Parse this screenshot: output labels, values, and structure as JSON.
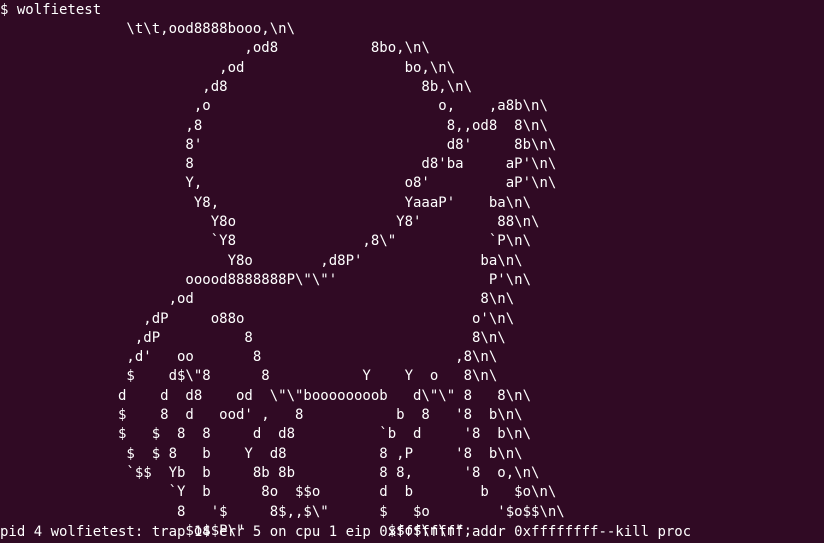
{
  "terminal": {
    "prompt": "$ wolfietest",
    "art_lines": [
      "               \\t\\t,ood8888booo,\\n\\",
      "                             ,od8           8bo,\\n\\",
      "                          ,od                   bo,\\n\\",
      "                        ,d8                       8b,\\n\\",
      "                       ,o                           o,    ,a8b\\n\\",
      "                      ,8                             8,,od8  8\\n\\",
      "                      8'                             d8'     8b\\n\\",
      "                      8                           d8'ba     aP'\\n\\",
      "                      Y,                        o8'         aP'\\n\\",
      "                       Y8,                      YaaaP'    ba\\n\\",
      "                         Y8o                   Y8'         88\\n\\",
      "                         `Y8               ,8\\\"           `P\\n\\",
      "                           Y8o        ,d8P'              ba\\n\\",
      "                      ooood8888888P\\\"\\\"'                  P'\\n\\",
      "                    ,od                                  8\\n\\",
      "                 ,dP     o88o                           o'\\n\\",
      "                ,dP          8                          8\\n\\",
      "               ,d'   oo       8                       ,8\\n\\",
      "               $    d$\\\"8      8           Y    Y  o   8\\n\\",
      "              d    d  d8    od  \\\"\\\"boooooooob   d\\\"\\\" 8   8\\n\\",
      "              $    8  d   ood' ,   8           b  8   '8  b\\n\\",
      "              $   $  8  8     d  d8          `b  d     '8  b\\n\\",
      "               $  $ 8   b    Y  d8           8 ,P     '8  b\\n\\",
      "               `$$  Yb  b     8b 8b          8 8,      '8  o,\\n\\",
      "                    `Y  b      8o  $$o       d  b        b   $o\\n\\",
      "                     8   '$     8$,,$\\\"      $   $o        '$o$$\\n\\",
      "                      $o$$P\\\"                 $$o$\\n\\n\";"
    ],
    "kill_message": "pid 4 wolfietest: trap 14 err 5 on cpu 1 eip 0xffffffff addr 0xffffffff--kill proc"
  },
  "colors": {
    "background": "#300a24",
    "foreground": "#ffffff"
  }
}
